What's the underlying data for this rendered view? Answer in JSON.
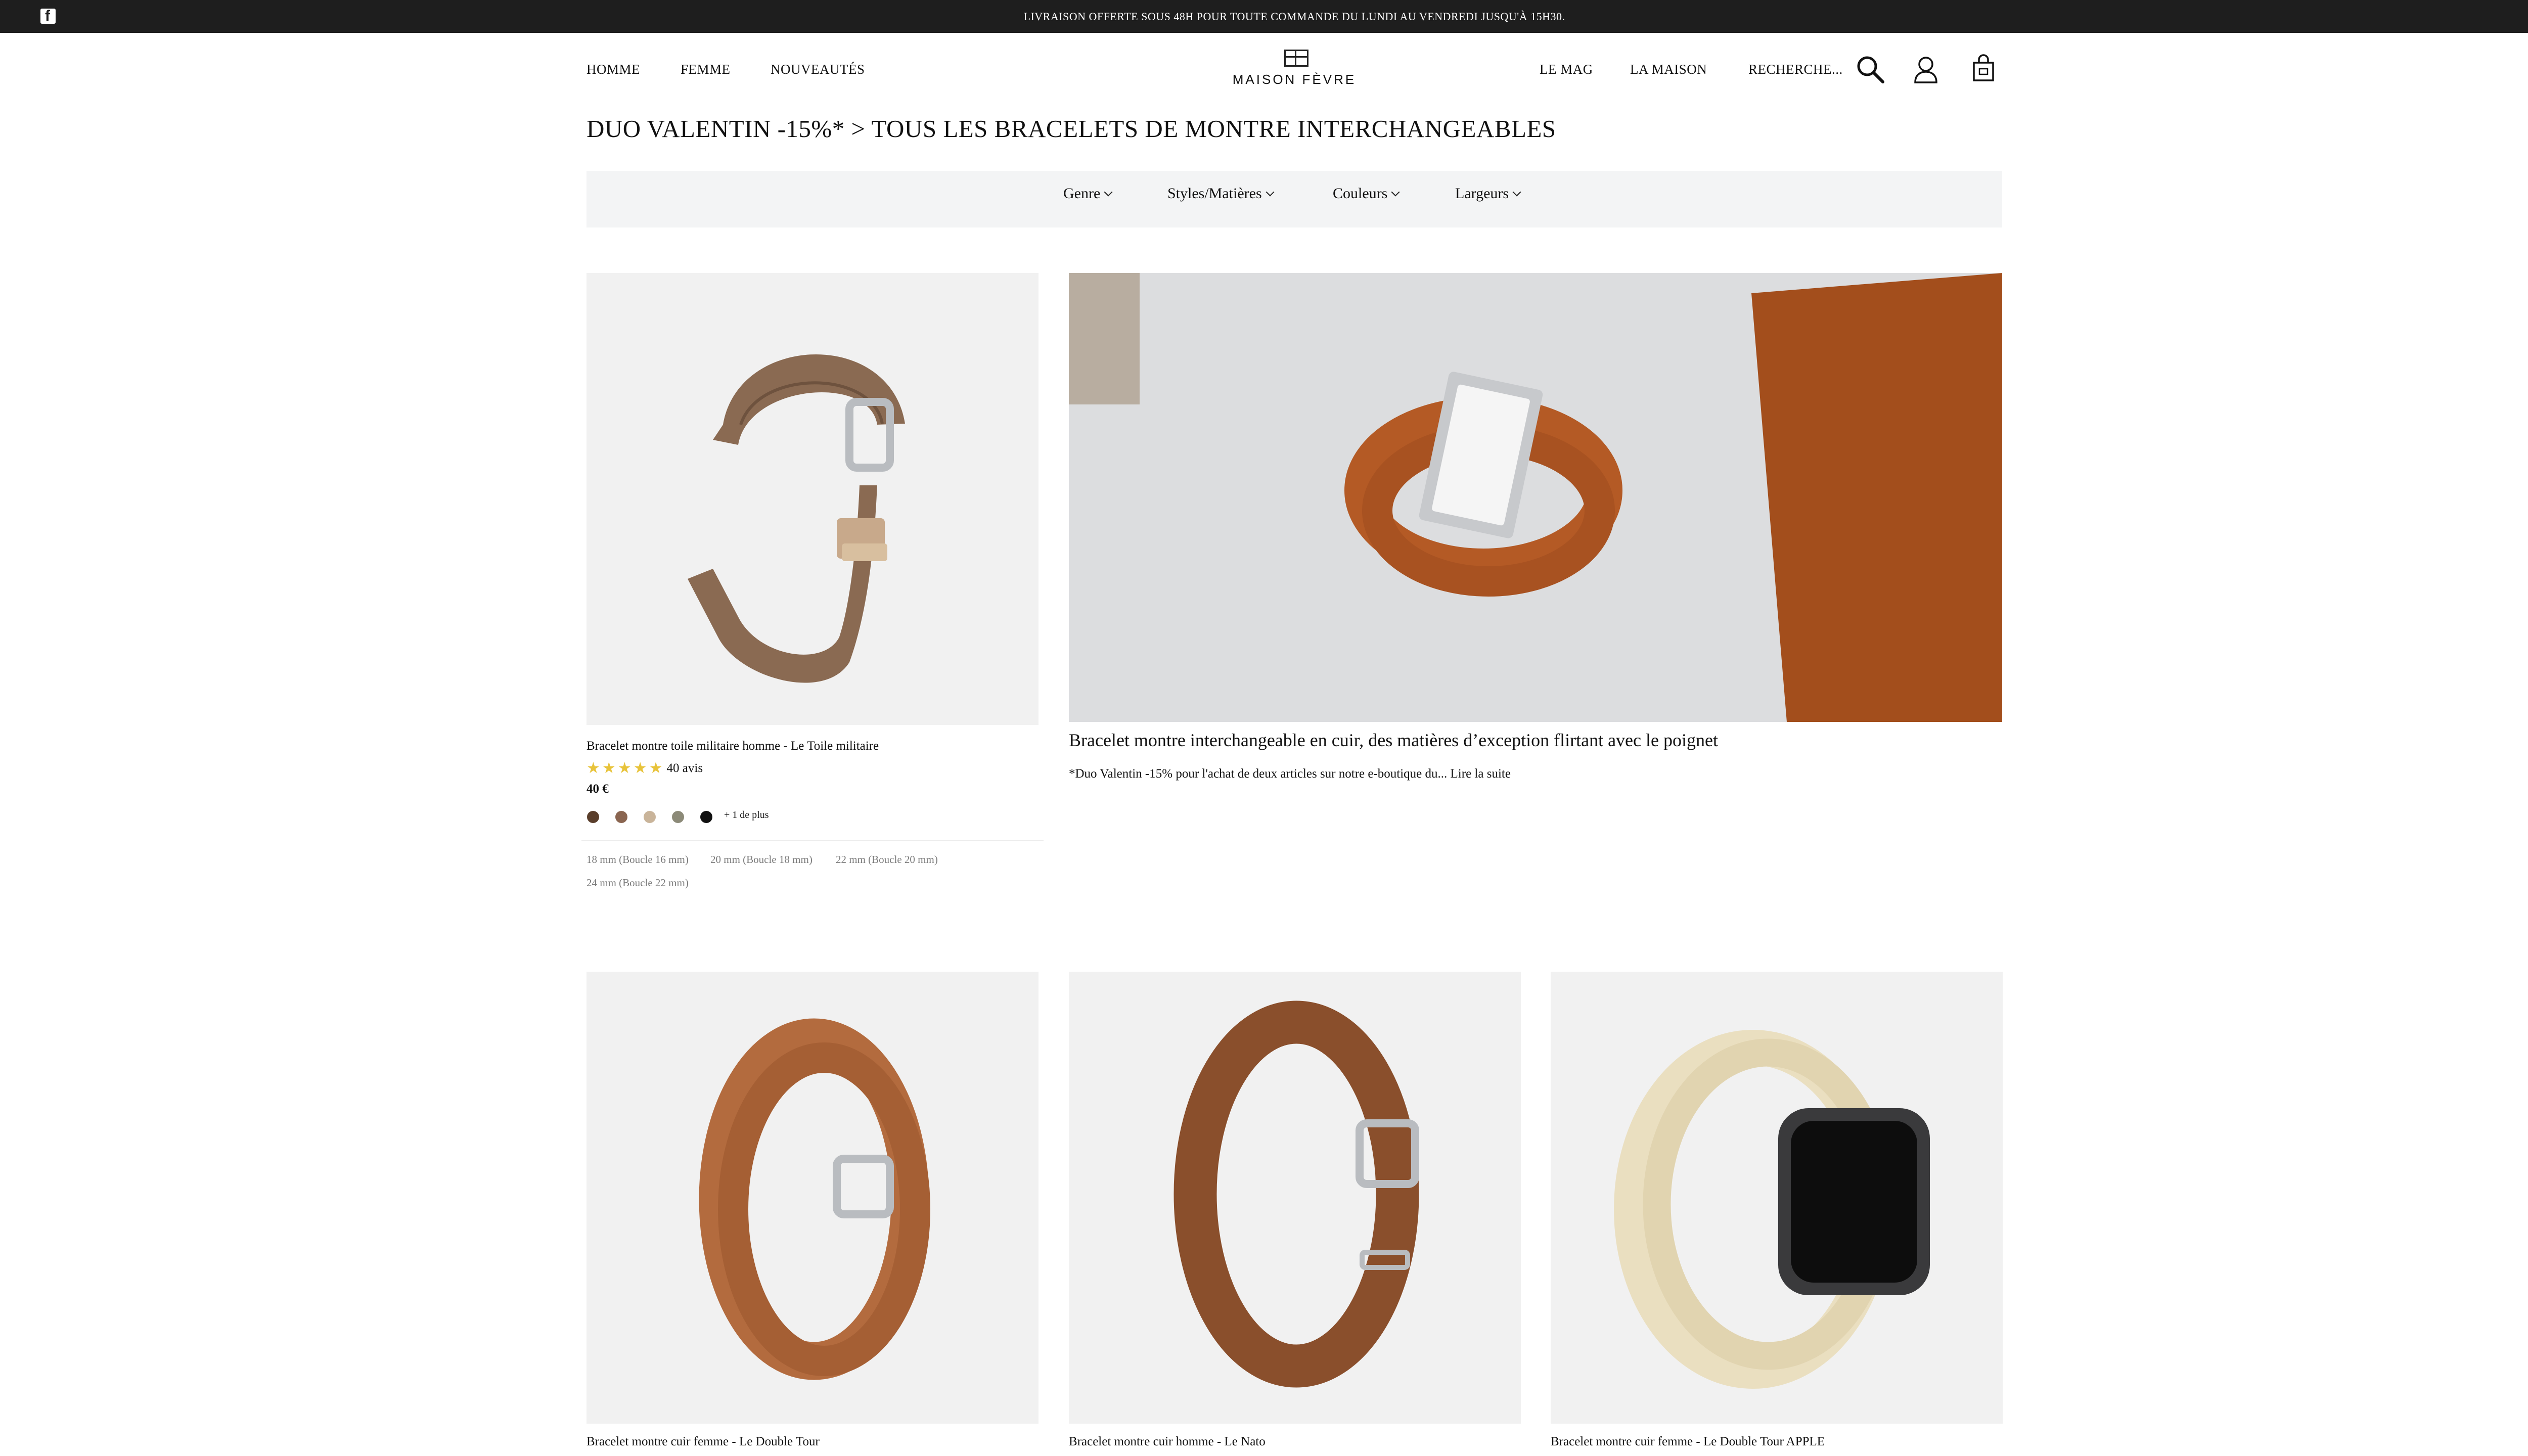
{
  "announcement": "LIVRAISON OFFERTE SOUS 48H POUR TOUTE COMMANDE DU LUNDI AU VENDREDI JUSQU'À 15H30.",
  "header": {
    "nav_left": [
      "HOMME",
      "FEMME",
      "NOUVEAUTÉS"
    ],
    "logo_text": "MAISON FÈVRE",
    "nav_right": [
      "LE MAG",
      "LA MAISON"
    ],
    "search_label": "RECHERCHE..."
  },
  "icons": {
    "social": "facebook-icon",
    "search": "search-icon",
    "account": "user-icon",
    "cart": "shopping-bag-icon"
  },
  "page_title": "DUO VALENTIN -15%* > TOUS LES BRACELETS DE MONTRE INTERCHANGEABLES",
  "filters": [
    "Genre",
    "Styles/Matières",
    "Couleurs",
    "Largeurs"
  ],
  "featured_product": {
    "name": "Bracelet montre toile militaire homme - Le Toile militaire",
    "rating_stars": 5,
    "reviews": "40 avis",
    "price": "40 €",
    "swatches": [
      "#5a3e2b",
      "#8a6550",
      "#c9b49a",
      "#8c8a78",
      "#111111"
    ],
    "more_colors": "+ 1 de plus",
    "sizes": [
      "18 mm (Boucle 16 mm)",
      "20 mm (Boucle 18 mm)",
      "22 mm (Boucle 20 mm)",
      "24 mm (Boucle 22 mm)"
    ]
  },
  "banner": {
    "title": "Bracelet montre interchangeable en cuir, des matières d’exception flirtant avec le poignet",
    "description": "*Duo Valentin -15% pour l'achat de deux articles sur notre e-boutique du...",
    "read_more": "Lire la suite"
  },
  "products": [
    {
      "name": "Bracelet montre cuir femme - Le Double Tour"
    },
    {
      "name": "Bracelet montre cuir homme - Le Nato"
    },
    {
      "name": "Bracelet montre cuir femme - Le Double Tour APPLE"
    }
  ]
}
